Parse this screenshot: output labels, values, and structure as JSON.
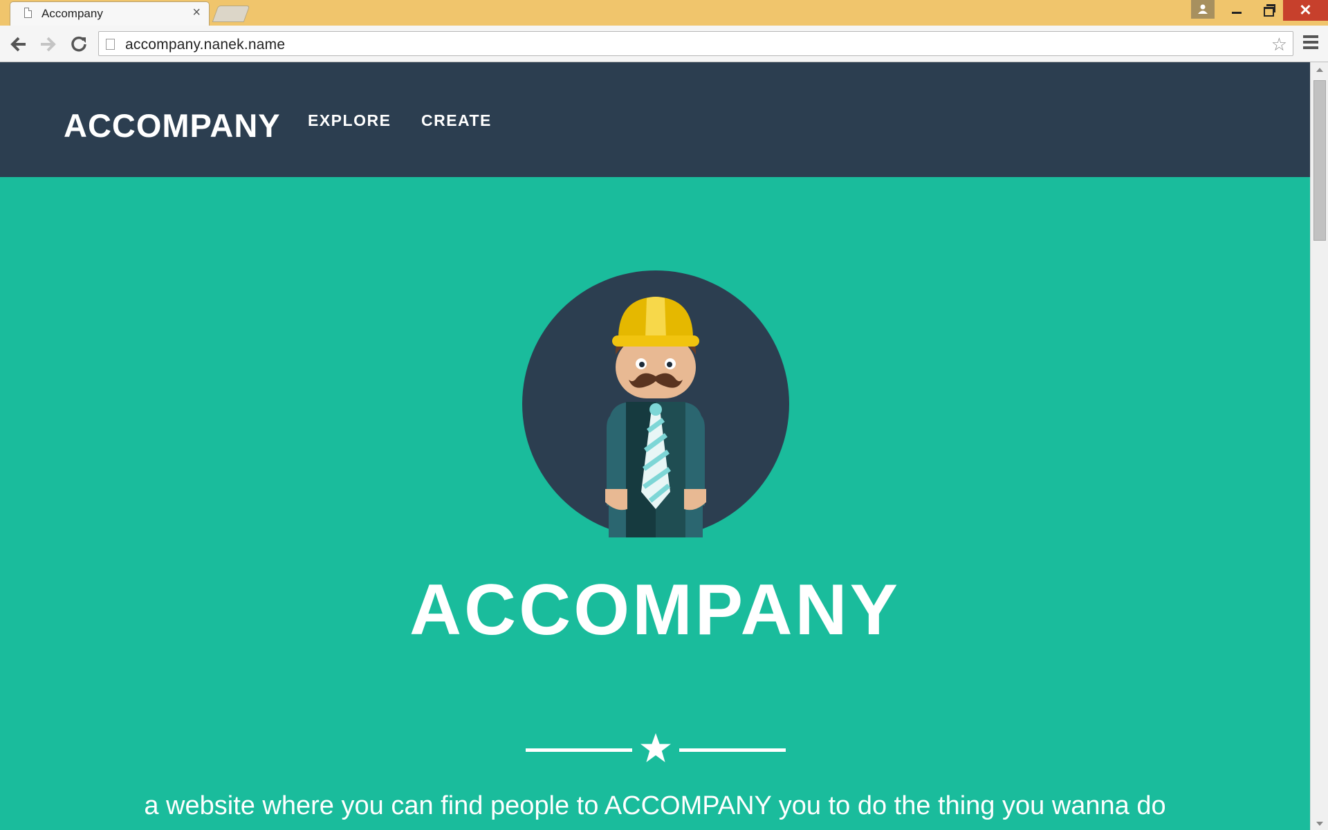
{
  "browser": {
    "tab_title": "Accompany",
    "tab_close_glyph": "×",
    "url": "accompany.nanek.name",
    "star_glyph": "☆",
    "close_glyph": "✕"
  },
  "site": {
    "brand": "ACCOMPANY",
    "nav": {
      "explore": "EXPLORE",
      "create": "CREATE"
    },
    "hero": {
      "title": "ACCOMPANY",
      "tagline": "a website where you can find people to ACCOMPANY you to do the thing you wanna do"
    }
  },
  "colors": {
    "nav_bg": "#2c3e50",
    "hero_bg": "#1abc9c",
    "titlebar": "#f0c56c",
    "helmet": "#f1c40f"
  }
}
